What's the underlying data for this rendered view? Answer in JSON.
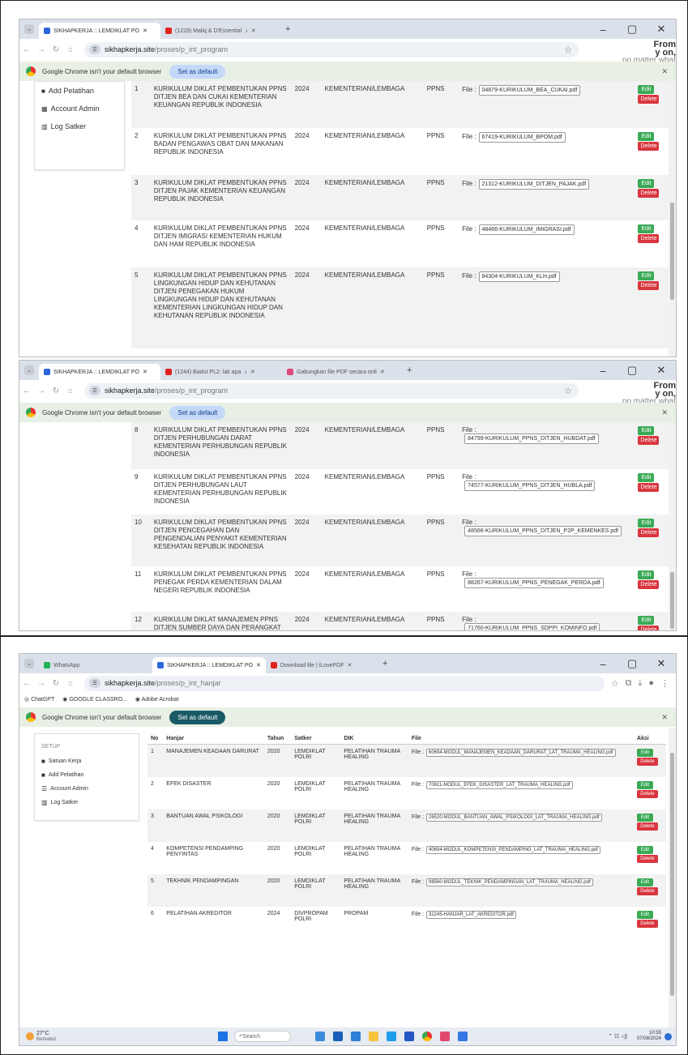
{
  "screens": {
    "s1": {
      "tabs": [
        "SIKHAPKERJA :: LEMDIKLAT PO",
        "(1229) Maliq & D'Essential"
      ],
      "address": {
        "site": "sikhapkerja.site",
        "path": "/proses/p_int_program"
      },
      "overlay": [
        "From",
        "y on,",
        "no matter what happens"
      ],
      "infobar": {
        "text": "Google Chrome isn't your default browser",
        "button": "Set as default"
      },
      "sidebar": [
        "Add Pelatihan",
        "Account Admin",
        "Log Satker"
      ],
      "rows": [
        {
          "no": "1",
          "title": "KURIKULUM DIKLAT PEMBENTUKAN PPNS DITJEN BEA DAN CUKAI KEMENTERIAN KEUANGAN REPUBLIK INDONESIA",
          "year": "2024",
          "cat": "KEMENTERIAN/LEMBAGA",
          "type": "PPNS",
          "file": "04879-KURIKULUM_BEA_CUKAI.pdf"
        },
        {
          "no": "2",
          "title": "KURIKULUM DIKLAT PEMBENTUKAN PPNS BADAN PENGAWAS OBAT DAN MAKANAN REPUBLIK INDONESIA",
          "year": "2024",
          "cat": "KEMENTERIAN/LEMBAGA",
          "type": "PPNS",
          "file": "67419-KURIKULUM_BPOM.pdf"
        },
        {
          "no": "3",
          "title": "KURIKULUM DIKLAT PEMBENTUKAN PPNS DITJEN PAJAK KEMENTERIAN KEUANGAN REPUBLIK INDONESIA",
          "year": "2024",
          "cat": "KEMENTERIAN/LEMBAGA",
          "type": "PPNS",
          "file": "21312-KURIKULUM_DITJEN_PAJAK.pdf"
        },
        {
          "no": "4",
          "title": "KURIKULUM DIKLAT PEMBENTUKAN PPNS DITJEN IMIGRASI KEMENTERIAN HUKUM DAN HAM REPUBLIK INDONESIA",
          "year": "2024",
          "cat": "KEMENTERIAN/LEMBAGA",
          "type": "PPNS",
          "file": "48466-KURIKULUM_IMIGRASI.pdf"
        },
        {
          "no": "5",
          "title": "KURIKULUM DIKLAT PEMBENTUKAN PPNS LINGKUNGAN HIDUP DAN KEHUTANAN DITJEN PENEGAKAN HUKUM LINGKUNGAN HIDUP DAN KEHUTANAN KEMENTERIAN LINGKUNGAN HIDUP DAN KEHUTANAN REPUBLIK INDONESIA",
          "year": "2024",
          "cat": "KEMENTERIAN/LEMBAGA",
          "type": "PPNS",
          "file": "84304-KURIKULUM_KLH.pdf"
        }
      ]
    },
    "s2": {
      "tabs": [
        "SIKHAPKERJA :: LEMDIKLAT PO",
        "(1244) Badut PL2: lak apa",
        "Gabungkan file PDF secara onli"
      ],
      "address": {
        "site": "sikhapkerja.site",
        "path": "/proses/p_int_program"
      },
      "overlay": [
        "From",
        "y on,",
        "no matter what happens"
      ],
      "infobar": {
        "text": "Google Chrome isn't your default browser",
        "button": "Set as default"
      },
      "rows": [
        {
          "no": "8",
          "title": "KURIKULUM DIKLAT PEMBENTUKAN PPNS DITJEN PERHUBUNGAN DARAT KEMENTERIAN PERHUBUNGAN REPUBLIK INDONESIA",
          "year": "2024",
          "cat": "KEMENTERIAN/LEMBAGA",
          "type": "PPNS",
          "file": "84799-KURIKULUM_PPNS_DITJEN_HUBDAT.pdf"
        },
        {
          "no": "9",
          "title": "KURIKULUM DIKLAT PEMBENTUKAN PPNS DITJEN PERHUBUNGAN LAUT KEMENTERIAN PERHUBUNGAN REPUBLIK INDONESIA",
          "year": "2024",
          "cat": "KEMENTERIAN/LEMBAGA",
          "type": "PPNS",
          "file": "74577-KURIKULUM_PPNS_DITJEN_HUBLA.pdf"
        },
        {
          "no": "10",
          "title": "KURIKULUM DIKLAT PEMBENTUKAN PPNS DITJEN PENCEGAHAN DAN PENGENDALIAN PENYAKIT KEMENTERIAN KESEHATAN REPUBLIK INDONESIA",
          "year": "2024",
          "cat": "KEMENTERIAN/LEMBAGA",
          "type": "PPNS",
          "file": "48566-KURIKULUM_PPNS_DITJEN_P2P_KEMENKES.pdf"
        },
        {
          "no": "11",
          "title": "KURIKULUM DIKLAT PEMBENTUKAN PPNS PENEGAK PERDA KEMENTERIAN DALAM NEGERI REPUBLIK INDONESIA",
          "year": "2024",
          "cat": "KEMENTERIAN/LEMBAGA",
          "type": "PPNS",
          "file": "88267-KURIKULUM_PPNS_PENEGAK_PERDA.pdf"
        },
        {
          "no": "12",
          "title": "KURIKULUM DIKLAT MANAJEMEN PPNS DITJEN SUMBER DAYA DAN PERANGKAT POS DAN INFORMATIKA (SDPPI) KEMENTERIAN KOMUNIKASI DAN",
          "year": "2024",
          "cat": "KEMENTERIAN/LEMBAGA",
          "type": "PPNS",
          "file": "71760-KURIKULUM_PPNS_SDPPI_KOMINFO.pdf"
        }
      ]
    },
    "s3": {
      "tabs": [
        "WhatsApp",
        "SIKHAPKERJA :: LEMDIKLAT PO",
        "Download file | iLovePDF"
      ],
      "address": {
        "site": "sikhapkerja.site",
        "path": "/proses/p_int_hanjar"
      },
      "bookmarks": [
        "ChatGPT",
        "GOOGLE CLASSRO...",
        "Adobe Acrobat"
      ],
      "infobar": {
        "text": "Google Chrome isn't your default browser",
        "button": "Set as default"
      },
      "sidebar_title": "SETUP",
      "sidebar": [
        "Satuan Kerja",
        "Add Pelatihan",
        "Account Admin",
        "Log Satker"
      ],
      "headers": [
        "No",
        "Hanjar",
        "Tahun",
        "Satker",
        "DIK",
        "File",
        "Aksi"
      ],
      "rows": [
        {
          "no": "1",
          "title": "MANAJEMEN KEADAAN DARURAT",
          "year": "2020",
          "satker": "LEMDIKLAT POLRI",
          "dik": "PELATIHAN TRAUMA HEALING",
          "file": "60694-MODUL_MANAJEMEN_KEADAAN_DARURAT_LAT_TRAUMA_HEALING.pdf"
        },
        {
          "no": "2",
          "title": "EFEK DISASTER",
          "year": "2020",
          "satker": "LEMDIKLAT POLRI",
          "dik": "PELATIHAN TRAUMA HEALING",
          "file": "70611-MODUL_EFEK_DISASTER_LAT_TRAUMA_HEALING.pdf"
        },
        {
          "no": "3",
          "title": "BANTUAN AWAL PSIKOLOGI",
          "year": "2020",
          "satker": "LEMDIKLAT POLRI",
          "dik": "PELATIHAN TRAUMA HEALING",
          "file": "26520-MODUL_BANTUAN_AWAL_PSIKOLOGI_LAT_TRAUMA_HEALING.pdf"
        },
        {
          "no": "4",
          "title": "KOMPETENSI PENDAMPING PENYINTAS",
          "year": "2020",
          "satker": "LEMDIKLAT POLRI",
          "dik": "PELATIHAN TRAUMA HEALING",
          "file": "40694-MODUL_KOMPETENSI_PENDAMPING_LAT_TRAUMA_HEALING.pdf"
        },
        {
          "no": "5",
          "title": "TEKHNIK PENDAMPINGAN",
          "year": "2020",
          "satker": "LEMDIKLAT POLRI",
          "dik": "PELATIHAN TRAUMA HEALING",
          "file": "98560-MODUL_TEKNIK_PENDAMPINGAN_LAT_TRAUMA_HEALING.pdf"
        },
        {
          "no": "6",
          "title": "PELATIHAN AKREDITOR",
          "year": "2024",
          "satker": "DIVPROPAM POLRI",
          "dik": "PROPAM",
          "file": "32245-HANJAR_LAT_AKREDITOR.pdf"
        }
      ],
      "taskbar": {
        "weather": "27°C",
        "weather_sub": "Berkabut",
        "search": "Search",
        "time": "10:55",
        "date": "07/08/2024"
      }
    },
    "common": {
      "file_label": "File :",
      "edit": "Edit",
      "delete": "Delete"
    }
  }
}
